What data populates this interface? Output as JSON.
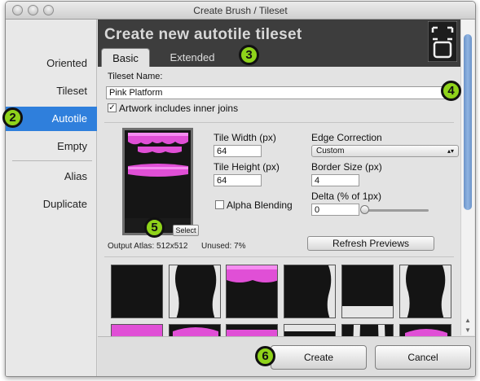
{
  "window": {
    "title": "Create Brush / Tileset"
  },
  "sidebar": {
    "items": [
      {
        "label": "Oriented",
        "selected": false
      },
      {
        "label": "Tileset",
        "selected": false
      },
      {
        "label": "Autotile",
        "selected": true
      },
      {
        "label": "Empty",
        "selected": false
      },
      {
        "label": "Alias",
        "selected": false
      },
      {
        "label": "Duplicate",
        "selected": false
      }
    ]
  },
  "header": {
    "title": "Create new autotile tileset",
    "tabs": [
      {
        "label": "Basic",
        "active": true
      },
      {
        "label": "Extended",
        "active": false
      }
    ]
  },
  "form": {
    "tileset_name_label": "Tileset Name:",
    "tileset_name_value": "Pink Platform",
    "artwork_inner_joins_label": "Artwork includes inner joins",
    "artwork_inner_joins_checked": true,
    "select_button_label": "Select",
    "tile_width_label": "Tile Width (px)",
    "tile_width_value": "64",
    "tile_height_label": "Tile Height (px)",
    "tile_height_value": "64",
    "alpha_blending_label": "Alpha Blending",
    "alpha_blending_checked": false,
    "edge_correction_label": "Edge Correction",
    "edge_correction_value": "Custom",
    "border_size_label": "Border Size (px)",
    "border_size_value": "4",
    "delta_label": "Delta (% of 1px)",
    "delta_value": "0",
    "delta_slider_fraction": 0.0,
    "output_atlas_text": "Output Atlas: 512x512",
    "unused_text": "Unused: 7%",
    "refresh_button_label": "Refresh Previews"
  },
  "footer": {
    "create_label": "Create",
    "cancel_label": "Cancel"
  },
  "callouts": [
    "2",
    "3",
    "4",
    "5",
    "6"
  ],
  "colors": {
    "accent": "#2f7fdc",
    "header_bg": "#3d3d3d",
    "callout": "#8fd31a",
    "tile_pink": "#e655e0",
    "tile_dark": "#141414",
    "tile_light": "#e6e6e6"
  }
}
